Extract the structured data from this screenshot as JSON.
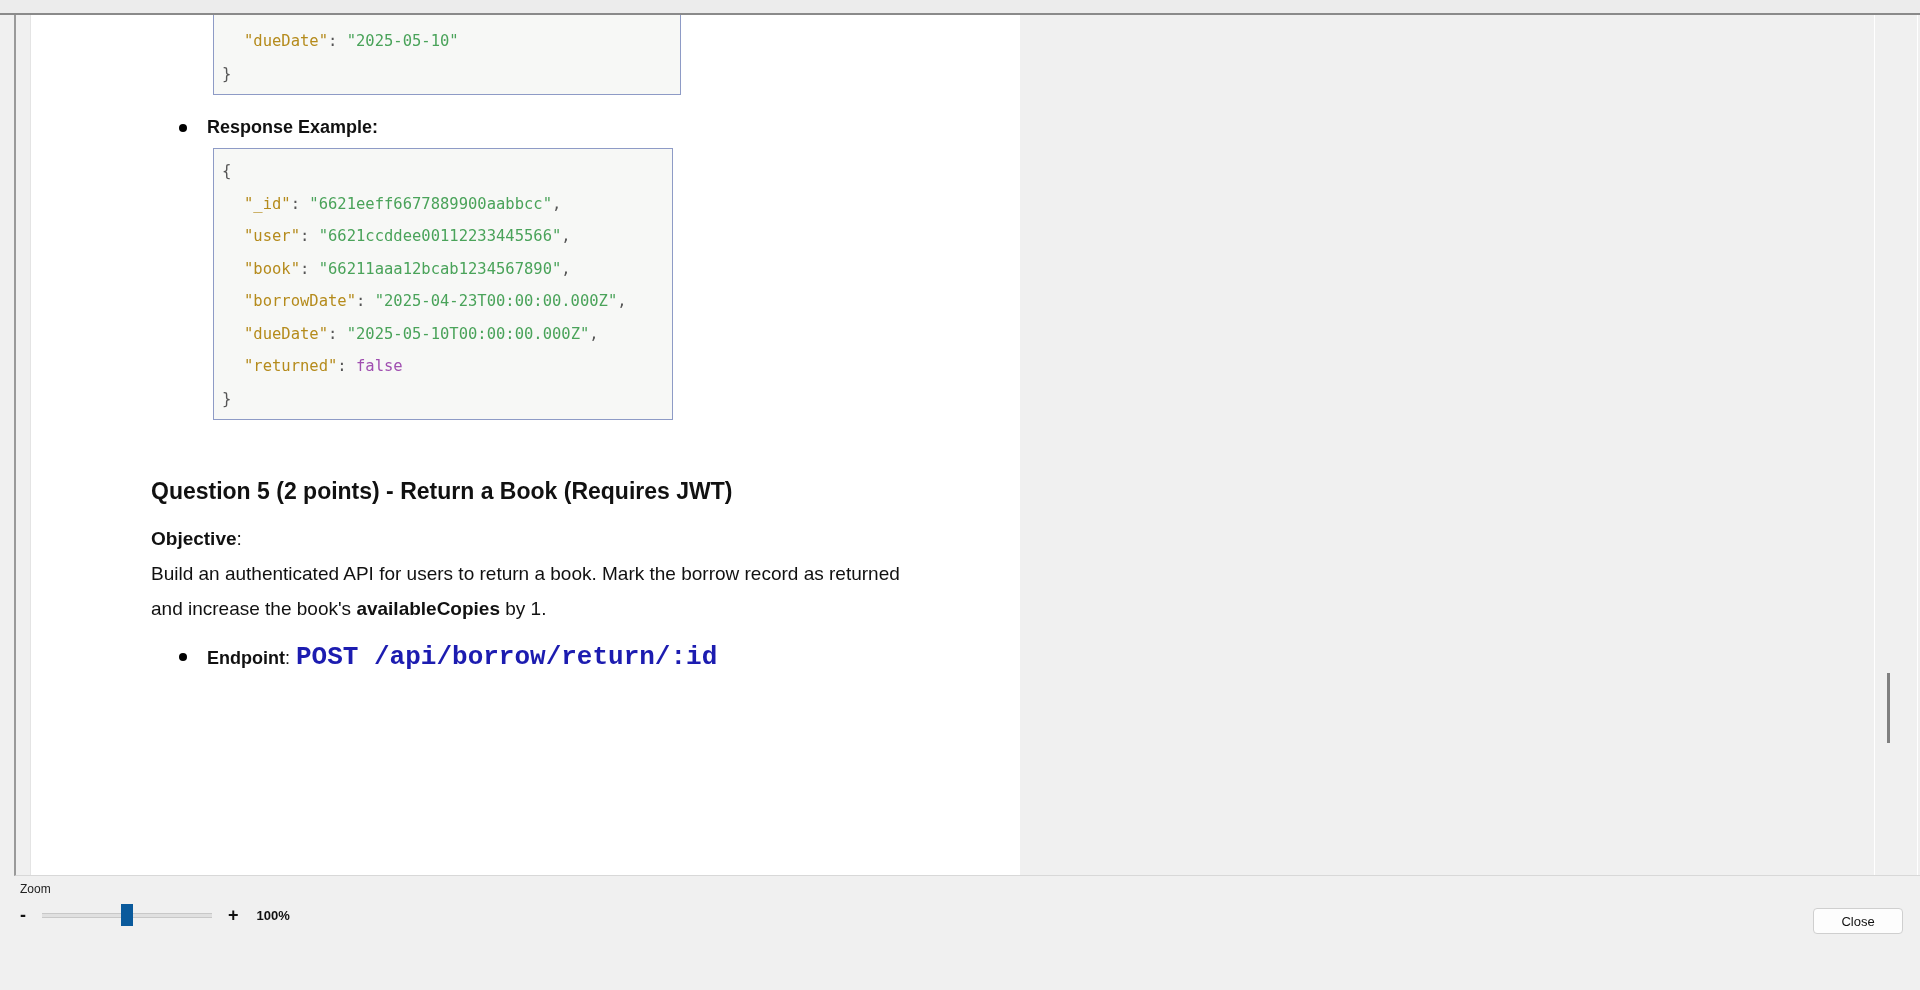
{
  "document": [
    {
      "kind": "code",
      "cut_top": true,
      "lines": [
        [
          {
            "kind": "key",
            "text": "\"dueDate\""
          },
          {
            "kind": "punct",
            "text": ": "
          },
          {
            "kind": "string",
            "text": "\"2025-05-10\""
          }
        ],
        [
          {
            "kind": "punct",
            "text": "}"
          }
        ]
      ]
    },
    {
      "kind": "bullet",
      "text": "Response Example:"
    },
    {
      "kind": "code",
      "cut_top": false,
      "lines": [
        [
          {
            "kind": "punct",
            "text": "{"
          }
        ],
        [
          {
            "kind": "key",
            "text": "\"_id\""
          },
          {
            "kind": "punct",
            "text": ": "
          },
          {
            "kind": "string",
            "text": "\"6621eeff6677889900aabbcc\""
          },
          {
            "kind": "punct",
            "text": ","
          }
        ],
        [
          {
            "kind": "key",
            "text": "\"user\""
          },
          {
            "kind": "punct",
            "text": ": "
          },
          {
            "kind": "string",
            "text": "\"6621ccddee00112233445566\""
          },
          {
            "kind": "punct",
            "text": ","
          }
        ],
        [
          {
            "kind": "key",
            "text": "\"book\""
          },
          {
            "kind": "punct",
            "text": ": "
          },
          {
            "kind": "string",
            "text": "\"66211aaa12bcab1234567890\""
          },
          {
            "kind": "punct",
            "text": ","
          }
        ],
        [
          {
            "kind": "key",
            "text": "\"borrowDate\""
          },
          {
            "kind": "punct",
            "text": ": "
          },
          {
            "kind": "string",
            "text": "\"2025-04-23T00:00:00.000Z\""
          },
          {
            "kind": "punct",
            "text": ","
          }
        ],
        [
          {
            "kind": "key",
            "text": "\"dueDate\""
          },
          {
            "kind": "punct",
            "text": ": "
          },
          {
            "kind": "string",
            "text": "\"2025-05-10T00:00:00.000Z\""
          },
          {
            "kind": "punct",
            "text": ","
          }
        ],
        [
          {
            "kind": "key",
            "text": "\"returned\""
          },
          {
            "kind": "punct",
            "text": ": "
          },
          {
            "kind": "bool",
            "text": "false"
          }
        ],
        [
          {
            "kind": "punct",
            "text": "}"
          }
        ]
      ]
    },
    {
      "kind": "heading",
      "text": "Question 5 (2 points) - Return a Book (Requires JWT)"
    },
    {
      "kind": "paragraph",
      "lines": [
        "**Objective**:",
        "Build an authenticated API for users to return a book. Mark the borrow record as returned",
        "and increase the book's **availableCopies** by 1."
      ]
    },
    {
      "kind": "endpoint",
      "label": "**Endpoint**:",
      "code": "POST /api/borrow/return/:id"
    }
  ],
  "zoom": {
    "label": "Zoom",
    "minus": "-",
    "plus": "+",
    "level": 0.5,
    "reading": "100%"
  },
  "close_button": "Close"
}
